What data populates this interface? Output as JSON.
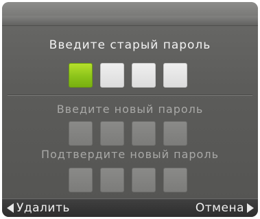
{
  "old_password": {
    "label": "Введите старый пароль",
    "digits": [
      "active",
      "empty",
      "empty",
      "empty"
    ]
  },
  "new_password": {
    "label": "Введите новый пароль",
    "digits": [
      "disabled",
      "disabled",
      "disabled",
      "disabled"
    ]
  },
  "confirm_password": {
    "label": "Подтвердите новый пароль",
    "digits": [
      "disabled",
      "disabled",
      "disabled",
      "disabled"
    ]
  },
  "softkeys": {
    "left_label": "Удалить",
    "left_icon": "arrow-left-icon",
    "right_label": "Отмена",
    "right_icon": "arrow-right-icon"
  },
  "colors": {
    "active_digit": "#8cc41a",
    "empty_digit": "#e6e6e6",
    "disabled_digit": "#828280",
    "background": "#5c5c5a"
  }
}
